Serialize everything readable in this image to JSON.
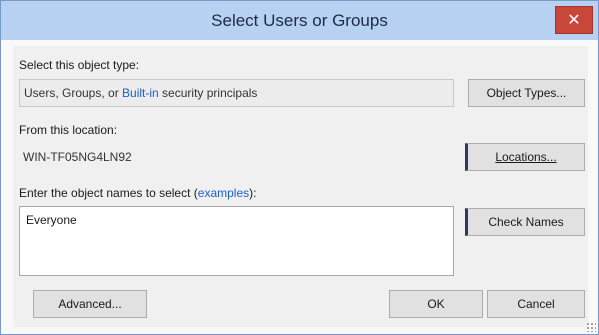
{
  "window": {
    "title": "Select Users or Groups",
    "close_glyph": "✕"
  },
  "object_type": {
    "label": "Select this object type:",
    "value_prefix": "Users, Groups, or ",
    "value_link": "Built-in",
    "value_suffix": " security principals",
    "button": "Object Types..."
  },
  "location": {
    "label": "From this location:",
    "value": "WIN-TF05NG4LN92",
    "button": "Locations..."
  },
  "object_names": {
    "label_prefix": "Enter the object names to select (",
    "label_link": "examples",
    "label_suffix": "):",
    "value": "Everyone",
    "button": "Check Names"
  },
  "footer": {
    "advanced": "Advanced...",
    "ok": "OK",
    "cancel": "Cancel"
  },
  "colors": {
    "titlebar": "#b6d1f1",
    "close": "#c9473a",
    "link": "#1b5fd2"
  }
}
